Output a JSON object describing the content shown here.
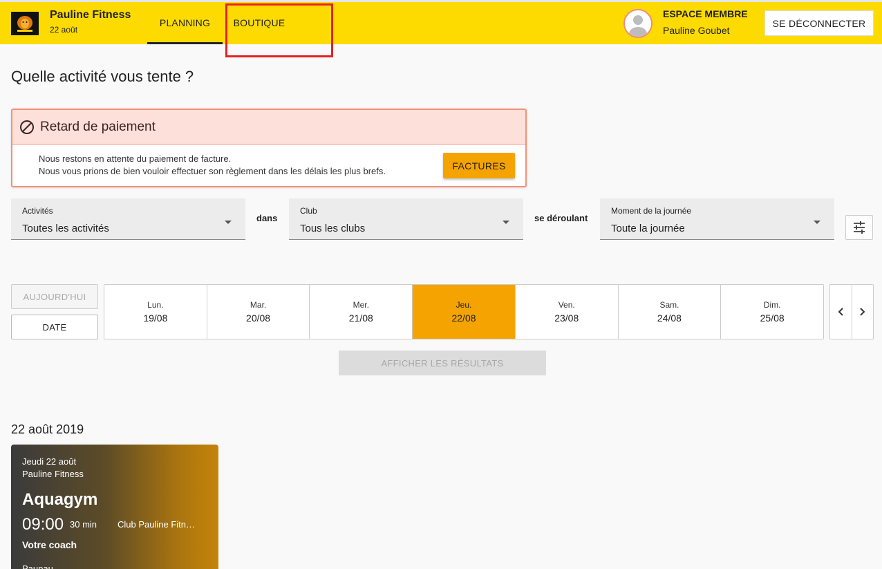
{
  "header": {
    "brand_name": "Pauline Fitness",
    "brand_date": "22 août",
    "tabs": [
      {
        "label": "PLANNING",
        "active": true
      },
      {
        "label": "BOUTIQUE",
        "active": false
      }
    ],
    "member_label": "ESPACE MEMBRE",
    "member_name": "Pauline Goubet",
    "logout_label": "SE DÉCONNECTER"
  },
  "main": {
    "title": "Quelle activité vous tente ?"
  },
  "alert": {
    "title": "Retard de paiement",
    "line1": "Nous restons en attente du paiement de facture.",
    "line2": "Nous vous prions de bien vouloir effectuer son règlement dans les délais les plus brefs.",
    "button_label": "FACTURES",
    "icon": "block-icon"
  },
  "filters": {
    "activites": {
      "label": "Activités",
      "value": "Toutes les activités"
    },
    "connector1": "dans",
    "club": {
      "label": "Club",
      "value": "Tous les clubs"
    },
    "connector2": "se déroulant",
    "moment": {
      "label": "Moment de la journée",
      "value": "Toute la journée"
    },
    "tune_icon": "tune-icon"
  },
  "dates": {
    "today_label": "AUJOURD'HUI",
    "date_label": "DATE",
    "days": [
      {
        "name": "Lun.",
        "date": "19/08"
      },
      {
        "name": "Mar.",
        "date": "20/08"
      },
      {
        "name": "Mer.",
        "date": "21/08"
      },
      {
        "name": "Jeu.",
        "date": "22/08",
        "active": true
      },
      {
        "name": "Ven.",
        "date": "23/08"
      },
      {
        "name": "Sam.",
        "date": "24/08"
      },
      {
        "name": "Dim.",
        "date": "25/08"
      }
    ]
  },
  "results_label": "AFFICHER LES RÉSULTATS",
  "results": {
    "date_heading": "22 août 2019",
    "cards": [
      {
        "day": "Jeudi 22 août",
        "club_top": "Pauline Fitness",
        "activity": "Aquagym",
        "time": "09:00",
        "duration": "30 min",
        "club": "Club Pauline Fitn…",
        "coach_label": "Votre coach",
        "coach": "Paupau"
      }
    ]
  },
  "colors": {
    "header_bg": "#fddb00",
    "accent": "#f5a300",
    "alert_border": "#f4907a",
    "alert_bg": "#fde0da",
    "highlight": "#e52121"
  }
}
